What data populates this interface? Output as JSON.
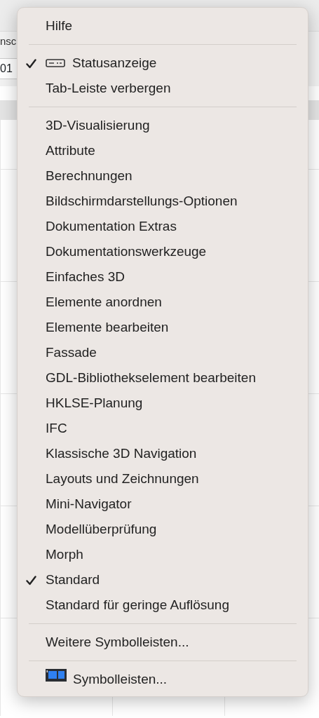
{
  "background": {
    "label_fragment": "nsc",
    "field_value": "01"
  },
  "menu": {
    "sections": [
      [
        {
          "label": "Hilfe",
          "checked": false,
          "kind": "plain"
        }
      ],
      [
        {
          "label": "Statusanzeige",
          "checked": true,
          "kind": "status-icon"
        },
        {
          "label": "Tab-Leiste verbergen",
          "checked": false,
          "kind": "plain"
        }
      ],
      [
        {
          "label": "3D-Visualisierung",
          "checked": false,
          "kind": "plain"
        },
        {
          "label": "Attribute",
          "checked": false,
          "kind": "plain"
        },
        {
          "label": "Berechnungen",
          "checked": false,
          "kind": "plain"
        },
        {
          "label": "Bildschirmdarstellungs-Optionen",
          "checked": false,
          "kind": "plain"
        },
        {
          "label": "Dokumentation Extras",
          "checked": false,
          "kind": "plain"
        },
        {
          "label": "Dokumentationswerkzeuge",
          "checked": false,
          "kind": "plain"
        },
        {
          "label": "Einfaches 3D",
          "checked": false,
          "kind": "plain"
        },
        {
          "label": "Elemente anordnen",
          "checked": false,
          "kind": "plain"
        },
        {
          "label": "Elemente bearbeiten",
          "checked": false,
          "kind": "plain"
        },
        {
          "label": "Fassade",
          "checked": false,
          "kind": "plain"
        },
        {
          "label": "GDL-Bibliothekselement bearbeiten",
          "checked": false,
          "kind": "plain"
        },
        {
          "label": "HKLSE-Planung",
          "checked": false,
          "kind": "plain"
        },
        {
          "label": "IFC",
          "checked": false,
          "kind": "plain"
        },
        {
          "label": "Klassische 3D Navigation",
          "checked": false,
          "kind": "plain"
        },
        {
          "label": "Layouts und Zeichnungen",
          "checked": false,
          "kind": "plain"
        },
        {
          "label": "Mini-Navigator",
          "checked": false,
          "kind": "plain"
        },
        {
          "label": "Modellüberprüfung",
          "checked": false,
          "kind": "plain"
        },
        {
          "label": "Morph",
          "checked": false,
          "kind": "plain"
        },
        {
          "label": "Standard",
          "checked": true,
          "kind": "plain"
        },
        {
          "label": "Standard für geringe Auflösung",
          "checked": false,
          "kind": "plain"
        }
      ],
      [
        {
          "label": "Weitere Symbolleisten...",
          "checked": false,
          "kind": "plain"
        }
      ],
      [
        {
          "label": "Symbolleisten...",
          "checked": false,
          "kind": "toolbar-icon"
        }
      ]
    ]
  }
}
